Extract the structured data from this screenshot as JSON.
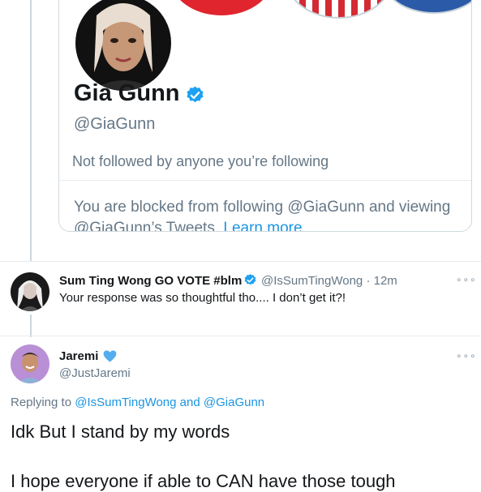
{
  "profile_card": {
    "name": "Gia Gunn",
    "handle": "@GiaGunn",
    "follow_status": "Not followed by anyone you’re following",
    "blocked_text": "You are blocked from following @GiaGunn and viewing @GiaGunn’s Tweets.",
    "learn_more": "Learn more"
  },
  "tweets": [
    {
      "name": "Sum Ting Wong GO VOTE #blm",
      "handle": "@IsSumTingWong",
      "separator": "·",
      "time": "12m",
      "text": "Your response was so thoughtful tho.... I don’t get it?!",
      "more": "∘∘∘"
    },
    {
      "name": "Jaremi",
      "handle": "@JustJaremi",
      "more": "∘∘∘",
      "replying_prefix": "Replying to",
      "replying_to_1": "@IsSumTingWong",
      "replying_and": "and",
      "replying_to_2": "@GiaGunn",
      "text_line_1": "Idk But I stand by my words",
      "text_line_2": "I hope everyone if able to CAN have those tough"
    }
  ],
  "colors": {
    "verified_blue": "#1da1f2",
    "heart_blue": "#55acee",
    "link_blue": "#1b95e0",
    "muted_gray": "#657786"
  },
  "icons": [
    "verified-badge-icon",
    "blue-heart-icon",
    "more-options-icon"
  ]
}
